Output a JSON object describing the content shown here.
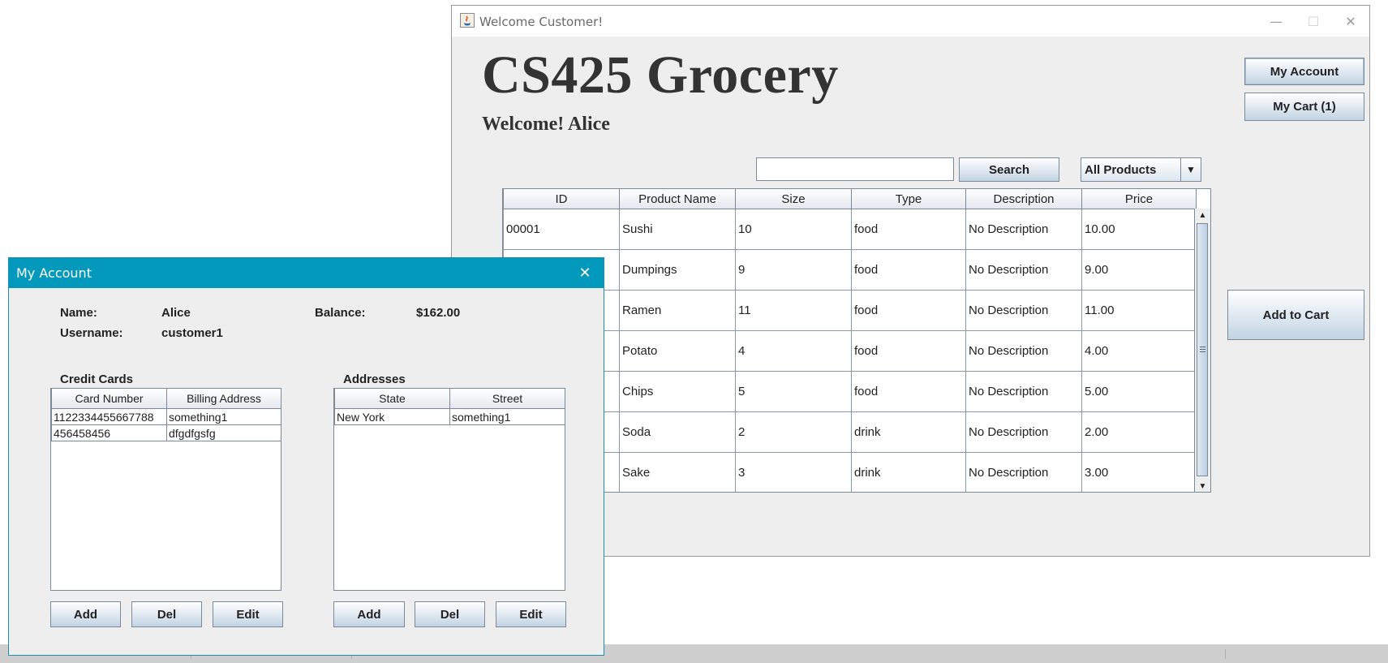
{
  "main_window": {
    "title": "Welcome Customer!",
    "controls": {
      "minimize": "—",
      "maximize": "☐",
      "close": "✕"
    },
    "store_title": "CS425 Grocery",
    "welcome": "Welcome! Alice",
    "buttons": {
      "my_account": "My Account",
      "my_cart": "My Cart (1)",
      "search": "Search",
      "add_to_cart": "Add to Cart"
    },
    "search": {
      "value": "",
      "placeholder": ""
    },
    "filter": {
      "selected": "All Products"
    },
    "table": {
      "columns": [
        "ID",
        "Product Name",
        "Size",
        "Type",
        "Description",
        "Price"
      ],
      "rows": [
        [
          "00001",
          "Sushi",
          "10",
          "food",
          "No Description",
          "10.00"
        ],
        [
          "",
          "Dumpings",
          "9",
          "food",
          "No Description",
          "9.00"
        ],
        [
          "",
          "Ramen",
          "11",
          "food",
          "No Description",
          "11.00"
        ],
        [
          "",
          "Potato",
          "4",
          "food",
          "No Description",
          "4.00"
        ],
        [
          "",
          "Chips",
          "5",
          "food",
          "No Description",
          "5.00"
        ],
        [
          "",
          "Soda",
          "2",
          "drink",
          "No Description",
          "2.00"
        ],
        [
          "",
          "Sake",
          "3",
          "drink",
          "No Description",
          "3.00"
        ]
      ]
    }
  },
  "dialog": {
    "title": "My Account",
    "close": "✕",
    "fields": {
      "name_label": "Name:",
      "name_value": "Alice",
      "username_label": "Username:",
      "username_value": "customer1",
      "balance_label": "Balance:",
      "balance_value": "$162.00"
    },
    "credit_cards": {
      "heading": "Credit Cards",
      "columns": [
        "Card Number",
        "Billing Address"
      ],
      "rows": [
        [
          "1122334455667788",
          "something1"
        ],
        [
          "456458456",
          "dfgdfgsfg"
        ]
      ],
      "buttons": {
        "add": "Add",
        "del": "Del",
        "edit": "Edit"
      }
    },
    "addresses": {
      "heading": "Addresses",
      "columns": [
        "State",
        "Street"
      ],
      "rows": [
        [
          "New York",
          "something1"
        ]
      ],
      "buttons": {
        "add": "Add",
        "del": "Del",
        "edit": "Edit"
      }
    }
  }
}
